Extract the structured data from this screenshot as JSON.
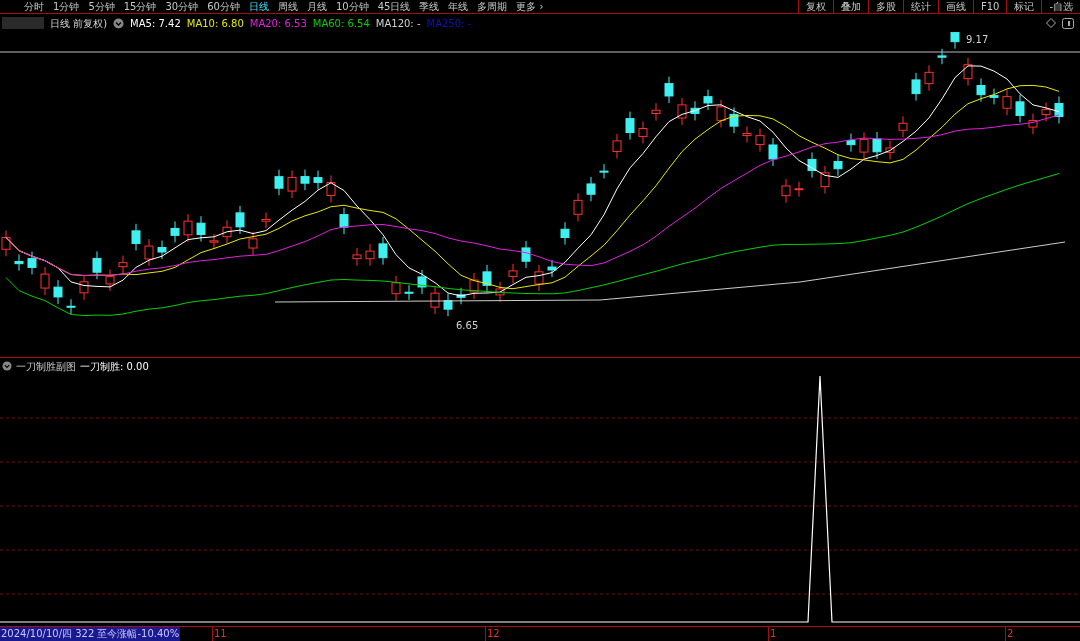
{
  "period_tabs": [
    {
      "label": "分时",
      "selected": false
    },
    {
      "label": "1分钟",
      "selected": false
    },
    {
      "label": "5分钟",
      "selected": false
    },
    {
      "label": "15分钟",
      "selected": false
    },
    {
      "label": "30分钟",
      "selected": false
    },
    {
      "label": "60分钟",
      "selected": false
    },
    {
      "label": "日线",
      "selected": true
    },
    {
      "label": "周线",
      "selected": false
    },
    {
      "label": "月线",
      "selected": false
    },
    {
      "label": "10分钟",
      "selected": false
    },
    {
      "label": "45日线",
      "selected": false
    },
    {
      "label": "季线",
      "selected": false
    },
    {
      "label": "年线",
      "selected": false
    },
    {
      "label": "多周期",
      "selected": false
    },
    {
      "label": "更多 ›",
      "selected": false
    }
  ],
  "tool_buttons": [
    "复权",
    "叠加",
    "多股",
    "统计",
    "画线",
    "F10",
    "标记",
    "-自选"
  ],
  "main_chart": {
    "title": "日线 前复权)",
    "indicators": [
      {
        "label": "MA5: 7.42",
        "color": "#ffffff"
      },
      {
        "label": "MA10: 6.80",
        "color": "#e8e800"
      },
      {
        "label": "MA20: 6.53",
        "color": "#e020e0"
      },
      {
        "label": "MA60: 6.54",
        "color": "#00d000"
      },
      {
        "label": "MA120: -",
        "color": "#d0d0d0"
      },
      {
        "label": "MA250: -",
        "color": "#1010c0"
      }
    ],
    "high_label": "9.17",
    "low_label": "6.65"
  },
  "sub_chart": {
    "title": "一刀制胜副图",
    "indicator": "一刀制胜: 0.00"
  },
  "status_bar": {
    "info": "2024/10/10/四 322 至今涨幅-10.40%",
    "date_ticks": [
      "11",
      "12",
      "1",
      "2"
    ]
  }
}
